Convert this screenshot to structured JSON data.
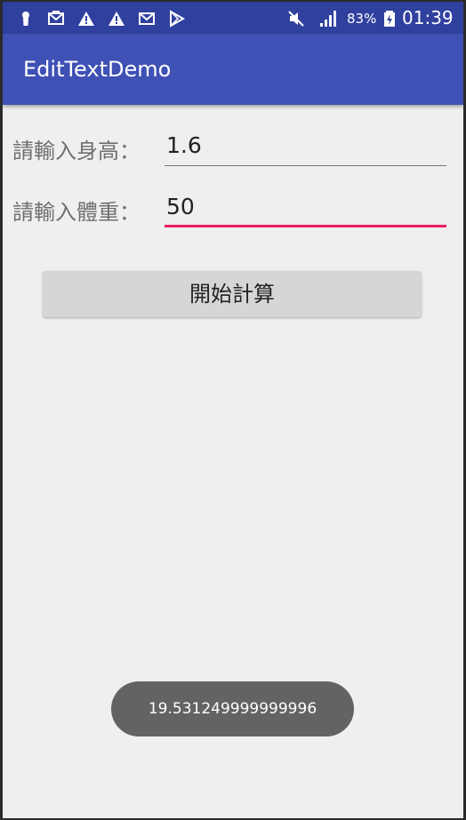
{
  "status_bar": {
    "left_icons": [
      "keyhole-icon",
      "mail-icon",
      "warning-icon",
      "warning-icon",
      "gmail-icon",
      "play-store-icon"
    ],
    "right_icons": [
      "mute-icon",
      "signal-icon",
      "battery-charging-icon"
    ],
    "battery_percent": "83%",
    "time": "01:39"
  },
  "app_bar": {
    "title": "EditTextDemo",
    "color": "#3f51b5"
  },
  "form": {
    "height_label": "請輸入身高：",
    "height_value": "1.6",
    "weight_label": "請輸入體重：",
    "weight_value": "50",
    "focus_color": "#e91e63"
  },
  "calc_button": {
    "label": "開始計算"
  },
  "toast": {
    "message": "19.531249999999996"
  }
}
